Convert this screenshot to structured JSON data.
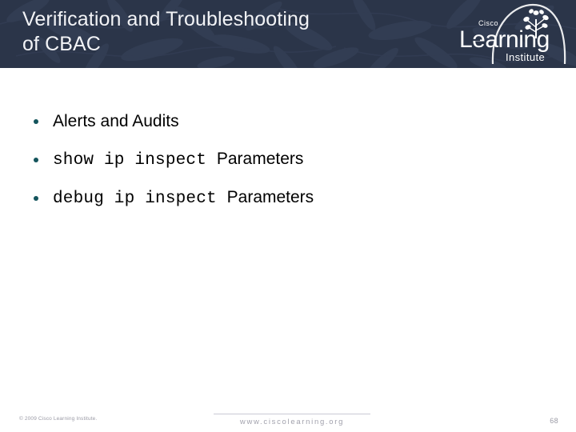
{
  "header": {
    "title": "Verification and Troubleshooting\nof CBAC",
    "background_color": "#2b3549",
    "title_color": "#f2f3f6"
  },
  "logo": {
    "brand_top": "Cisco",
    "brand_main": "Learning",
    "brand_sub": "Institute",
    "icon": "tree-arc-icon"
  },
  "content": {
    "bullets": [
      {
        "parts": [
          {
            "style": "sans",
            "text": "Alerts and Audits"
          }
        ],
        "plain": "Alerts and Audits"
      },
      {
        "parts": [
          {
            "style": "mono",
            "text": "show ip inspect "
          },
          {
            "style": "sans",
            "text": "Parameters"
          }
        ],
        "plain": "show ip inspect Parameters"
      },
      {
        "parts": [
          {
            "style": "mono",
            "text": "debug ip inspect "
          },
          {
            "style": "sans",
            "text": "Parameters"
          }
        ],
        "plain": "debug ip inspect Parameters"
      }
    ],
    "bullet_color": "#14545c",
    "text_color": "#000000"
  },
  "footer": {
    "copyright": "© 2009 Cisco Learning Institute.",
    "url": "www.ciscolearning.org",
    "page_number": "68"
  }
}
